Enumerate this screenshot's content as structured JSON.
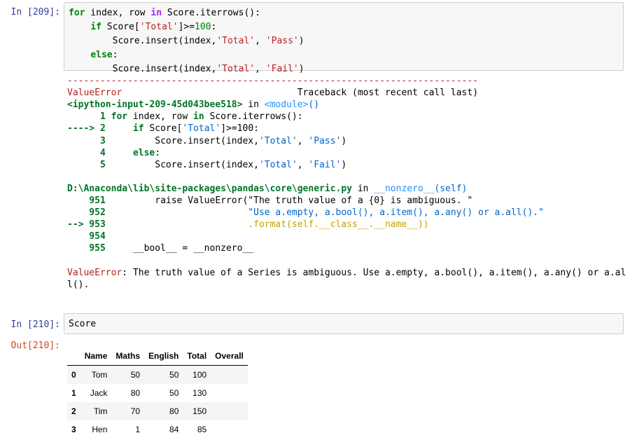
{
  "cell209": {
    "prompt": "In [209]:",
    "code": [
      [
        [
          "kw",
          "for"
        ],
        [
          "plain",
          " index, row "
        ],
        [
          "op",
          "in"
        ],
        [
          "plain",
          " Score.iterrows():"
        ]
      ],
      [
        [
          "plain",
          "    "
        ],
        [
          "kw",
          "if"
        ],
        [
          "plain",
          " Score["
        ],
        [
          "str",
          "'Total'"
        ],
        [
          "plain",
          "]>="
        ],
        [
          "num",
          "100"
        ],
        [
          "plain",
          ":"
        ]
      ],
      [
        [
          "plain",
          "        Score.insert(index,"
        ],
        [
          "str",
          "'Total'"
        ],
        [
          "plain",
          ", "
        ],
        [
          "str",
          "'Pass'"
        ],
        [
          "plain",
          ")"
        ]
      ],
      [
        [
          "plain",
          "    "
        ],
        [
          "kw",
          "else"
        ],
        [
          "plain",
          ":"
        ]
      ],
      [
        [
          "plain",
          "        Score.insert(index,"
        ],
        [
          "str",
          "'Total'"
        ],
        [
          "plain",
          ", "
        ],
        [
          "str",
          "'Fail'"
        ],
        [
          "plain",
          ")"
        ]
      ]
    ],
    "traceback": [
      [
        [
          "tb-red",
          "---------------------------------------------------------------------------"
        ]
      ],
      [
        [
          "tb-red",
          "ValueError"
        ],
        [
          "plain",
          "                                Traceback (most recent call last)"
        ]
      ],
      [
        [
          "tb-green",
          "<ipython-input-209-45d043bee518>"
        ],
        [
          "plain",
          " in "
        ],
        [
          "tb-cyan",
          "<module>"
        ],
        [
          "tb-blue",
          "()"
        ]
      ],
      [
        [
          "tb-green",
          "      1 "
        ],
        [
          "tb-green",
          "for"
        ],
        [
          "plain",
          " index, row "
        ],
        [
          "tb-green",
          "in"
        ],
        [
          "plain",
          " Score.iterrows():"
        ]
      ],
      [
        [
          "tb-green",
          "----> 2 "
        ],
        [
          "plain",
          "    "
        ],
        [
          "tb-green",
          "if"
        ],
        [
          "plain",
          " Score["
        ],
        [
          "tb-blue",
          "'Total'"
        ],
        [
          "plain",
          "]>=100:"
        ]
      ],
      [
        [
          "tb-green",
          "      3 "
        ],
        [
          "plain",
          "        Score.insert(index,"
        ],
        [
          "tb-blue",
          "'Total'"
        ],
        [
          "plain",
          ", "
        ],
        [
          "tb-blue",
          "'Pass'"
        ],
        [
          "plain",
          ")"
        ]
      ],
      [
        [
          "tb-green",
          "      4 "
        ],
        [
          "plain",
          "    "
        ],
        [
          "tb-green",
          "else"
        ],
        [
          "plain",
          ":"
        ]
      ],
      [
        [
          "tb-green",
          "      5 "
        ],
        [
          "plain",
          "        Score.insert(index,"
        ],
        [
          "tb-blue",
          "'Total'"
        ],
        [
          "plain",
          ", "
        ],
        [
          "tb-blue",
          "'Fail'"
        ],
        [
          "plain",
          ")"
        ]
      ],
      [
        [
          "plain",
          ""
        ]
      ],
      [
        [
          "tb-green",
          "D:\\Anaconda\\lib\\site-packages\\pandas\\core\\generic.py"
        ],
        [
          "plain",
          " in "
        ],
        [
          "tb-cyan",
          "__nonzero__"
        ],
        [
          "tb-blue",
          "(self)"
        ]
      ],
      [
        [
          "tb-green",
          "    951 "
        ],
        [
          "plain",
          "        raise ValueError(\"The truth value of a {0} is ambiguous. \""
        ]
      ],
      [
        [
          "tb-green",
          "    952 "
        ],
        [
          "plain",
          "                         "
        ],
        [
          "tb-blue",
          "\"Use a.empty, a.bool(), a.item(), a.any() or a.all().\""
        ]
      ],
      [
        [
          "tb-green",
          "--> 953 "
        ],
        [
          "plain",
          "                         "
        ],
        [
          "tb-gold",
          ".format(self.__class__.__name__))"
        ]
      ],
      [
        [
          "tb-green",
          "    954 "
        ]
      ],
      [
        [
          "tb-green",
          "    955 "
        ],
        [
          "plain",
          "    __bool__ = __nonzero__"
        ]
      ],
      [
        [
          "plain",
          ""
        ]
      ],
      [
        [
          "tb-red",
          "ValueError"
        ],
        [
          "plain",
          ": The truth value of a Series is ambiguous. Use a.empty, a.bool(), a.item(), a.any() or a.al"
        ]
      ],
      [
        [
          "plain",
          "l()."
        ]
      ]
    ]
  },
  "cell210": {
    "prompt": "In [210]:",
    "code": "Score",
    "out_prompt": "Out[210]:",
    "table": {
      "columns": [
        "",
        "Name",
        "Maths",
        "English",
        "Total",
        "Overall"
      ],
      "rows": [
        [
          "0",
          "Tom",
          "50",
          "50",
          "100",
          ""
        ],
        [
          "1",
          "Jack",
          "80",
          "50",
          "130",
          ""
        ],
        [
          "2",
          "Tim",
          "70",
          "80",
          "150",
          ""
        ],
        [
          "3",
          "Hen",
          "1",
          "84",
          "85",
          ""
        ]
      ]
    }
  }
}
